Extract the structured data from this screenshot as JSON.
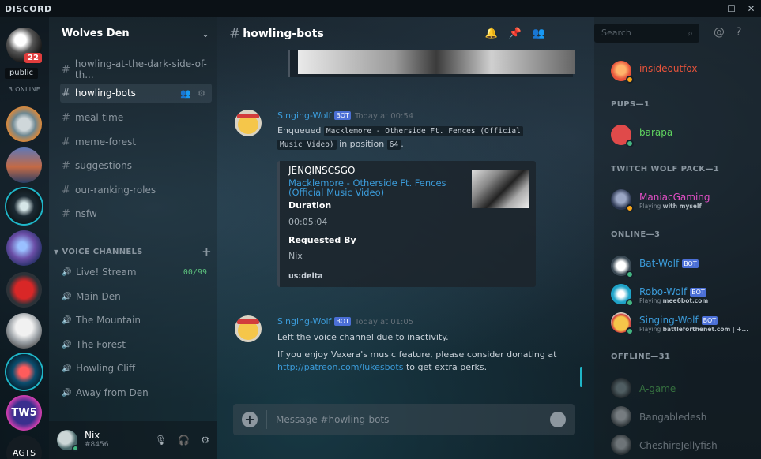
{
  "titlebar": {
    "app": "DISCORD",
    "minimize": "—",
    "maximize": "☐",
    "close": "✕"
  },
  "guilds": {
    "mention_count": "22",
    "server_label": "public",
    "online_text": "3 ONLINE",
    "last_server": "AGTS",
    "tw5": "TW5"
  },
  "server": {
    "name": "Wolves Den",
    "dropdown": "⌄"
  },
  "channels": [
    {
      "name": "howling-at-the-dark-side-of-th..."
    },
    {
      "name": "howling-bots"
    },
    {
      "name": "meal-time"
    },
    {
      "name": "meme-forest"
    },
    {
      "name": "suggestions"
    },
    {
      "name": "our-ranking-roles"
    },
    {
      "name": "nsfw"
    }
  ],
  "voice_header": "VOICE CHANNELS",
  "voice": [
    {
      "name": "Live! Stream",
      "count": "00/99"
    },
    {
      "name": "Main Den"
    },
    {
      "name": "The Mountain"
    },
    {
      "name": "The Forest"
    },
    {
      "name": "Howling Cliff"
    },
    {
      "name": "Away from Den"
    }
  ],
  "user": {
    "name": "Nix",
    "tag": "#8456"
  },
  "header": {
    "hash": "#",
    "channel": "howling-bots"
  },
  "search": {
    "placeholder": "Search"
  },
  "messages": [
    {
      "author": "Singing-Wolf",
      "bot": "BOT",
      "time": "Today at 00:54",
      "text_a": "Enqueued",
      "code_title": "Macklemore - Otherside Ft. Fences (Official",
      "code_title2": "Music Video)",
      "text_b": "in position",
      "code_pos": "64",
      "text_c": ".",
      "embed": {
        "title": "JENQINSCSGO",
        "link": "Macklemore - Otherside Ft. Fences (Official Music Video)",
        "duration_label": "Duration",
        "duration": "00:05:04",
        "requested_label": "Requested By",
        "requester": "Nix",
        "footer": "us:delta"
      }
    },
    {
      "author": "Singing-Wolf",
      "bot": "BOT",
      "time": "Today at 01:05",
      "line1": "Left the voice channel due to inactivity.",
      "line2": "If you enjoy Vexera's music feature, please consider donating at",
      "link": "http://patreon.com/lukesbots",
      "line3": "to get extra perks."
    }
  ],
  "composer": {
    "placeholder": "Message #howling-bots"
  },
  "members": {
    "top": {
      "name": "insideoutfox",
      "color": "#e8533b"
    },
    "groups": [
      {
        "title": "PUPS—1"
      },
      {
        "title": "TWITCH WOLF PACK—1"
      },
      {
        "title": "ONLINE—3"
      },
      {
        "title": "OFFLINE—31"
      }
    ],
    "pups": [
      {
        "name": "barapa",
        "color": "#5fd35f"
      }
    ],
    "twitch": [
      {
        "name": "ManiacGaming",
        "color": "#e34fc6",
        "sub_pre": "Playing",
        "sub_game": "with myself"
      }
    ],
    "online": [
      {
        "name": "Bat-Wolf",
        "bot": "BOT",
        "color": "#3b9bd9"
      },
      {
        "name": "Robo-Wolf",
        "bot": "BOT",
        "color": "#3b9bd9",
        "sub_pre": "Playing",
        "sub_game": "mee6bot.com"
      },
      {
        "name": "Singing-Wolf",
        "bot": "BOT",
        "color": "#3b9bd9",
        "sub_pre": "Playing",
        "sub_game": "battleforthenet.com | +..."
      }
    ],
    "offline": [
      {
        "name": "A-game",
        "color": "#5fd35f"
      },
      {
        "name": "Bangabledesh",
        "color": "#c9d1d9"
      },
      {
        "name": "CheshireJellyfish",
        "color": "#c9d1d9"
      }
    ]
  },
  "colors": {
    "accent_link": "#3b9bd9",
    "online": "#43b581",
    "idle": "#faa61a",
    "dnd": "#f04747",
    "bot_badge": "#4b6fd6"
  }
}
